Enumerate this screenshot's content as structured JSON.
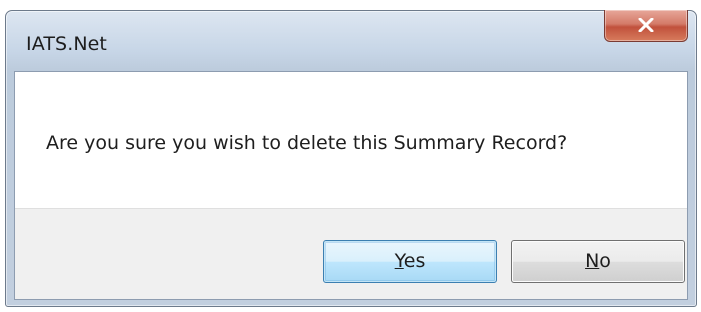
{
  "window": {
    "title": "IATS.Net",
    "close_icon": "close-icon"
  },
  "dialog": {
    "message": "Are you sure you wish to delete this Summary Record?"
  },
  "buttons": {
    "yes": {
      "mnemonic": "Y",
      "rest": "es"
    },
    "no": {
      "mnemonic": "N",
      "rest": "o"
    }
  },
  "colors": {
    "title_bar": "#c7d6e7",
    "close_button": "#c1513c",
    "default_button_border": "#3c7fb1",
    "button_area": "#f0f0f0"
  }
}
